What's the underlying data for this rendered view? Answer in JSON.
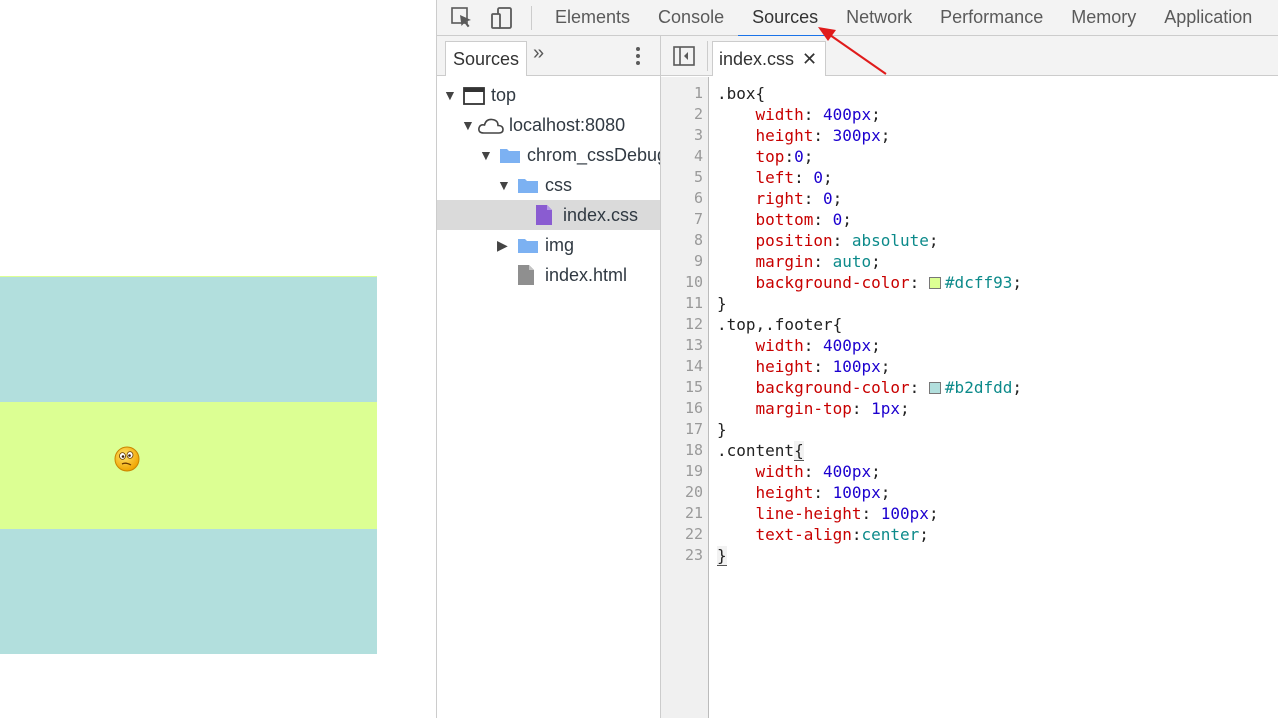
{
  "preview": {
    "colors": {
      "box": "#dcff93",
      "top_footer": "#b2dfdd"
    },
    "emoji_icon": "confused-face-icon"
  },
  "devtools": {
    "tabs": [
      {
        "label": "Elements"
      },
      {
        "label": "Console"
      },
      {
        "label": "Sources",
        "active": true
      },
      {
        "label": "Network"
      },
      {
        "label": "Performance"
      },
      {
        "label": "Memory"
      },
      {
        "label": "Application"
      }
    ],
    "accent": "#1a73e8"
  },
  "navigator": {
    "tab_label": "Sources",
    "more": "»",
    "tree": [
      {
        "label": "top",
        "icon": "frame-icon",
        "expanded": true
      },
      {
        "label": "localhost:8080",
        "icon": "cloud-icon",
        "expanded": true
      },
      {
        "label": "chrom_cssDebug",
        "icon": "folder-icon",
        "expanded": true
      },
      {
        "label": "css",
        "icon": "folder-icon",
        "expanded": true
      },
      {
        "label": "index.css",
        "icon": "css-file-icon",
        "selected": true
      },
      {
        "label": "img",
        "icon": "folder-icon",
        "expanded": false
      },
      {
        "label": "index.html",
        "icon": "file-icon"
      }
    ]
  },
  "editor": {
    "file_tab": "index.css",
    "close_glyph": "✕",
    "line_numbers": [
      "1",
      "2",
      "3",
      "4",
      "5",
      "6",
      "7",
      "8",
      "9",
      "10",
      "11",
      "12",
      "13",
      "14",
      "15",
      "16",
      "17",
      "18",
      "19",
      "20",
      "21",
      "22",
      "23"
    ],
    "code": {
      "l1_sel": ".box{",
      "l2_p": "width",
      "l2_v": "400px",
      "l3_p": "height",
      "l3_v": "300px",
      "l4_p": "top",
      "l4_v": "0",
      "l5_p": "left",
      "l5_v": "0",
      "l6_p": "right",
      "l6_v": "0",
      "l7_p": "bottom",
      "l7_v": "0",
      "l8_p": "position",
      "l8_v": "absolute",
      "l9_p": "margin",
      "l9_v": "auto",
      "l10_p": "background-color",
      "l10_v": "#dcff93",
      "l11": "}",
      "l12_sel": ".top,.footer{",
      "l13_p": "width",
      "l13_v": "400px",
      "l14_p": "height",
      "l14_v": "100px",
      "l15_p": "background-color",
      "l15_v": "#b2dfdd",
      "l16_p": "margin-top",
      "l16_v": "1px",
      "l17": "}",
      "l18_sel": ".content",
      "l18_brace": "{",
      "l19_p": "width",
      "l19_v": "400px",
      "l20_p": "height",
      "l20_v": "100px",
      "l21_p": "line-height",
      "l21_v": "100px",
      "l22_p": "text-align",
      "l22_v": "center",
      "l23": "}"
    },
    "swatch_colors": {
      "l10": "#dcff93",
      "l15": "#b2dfdd"
    }
  }
}
